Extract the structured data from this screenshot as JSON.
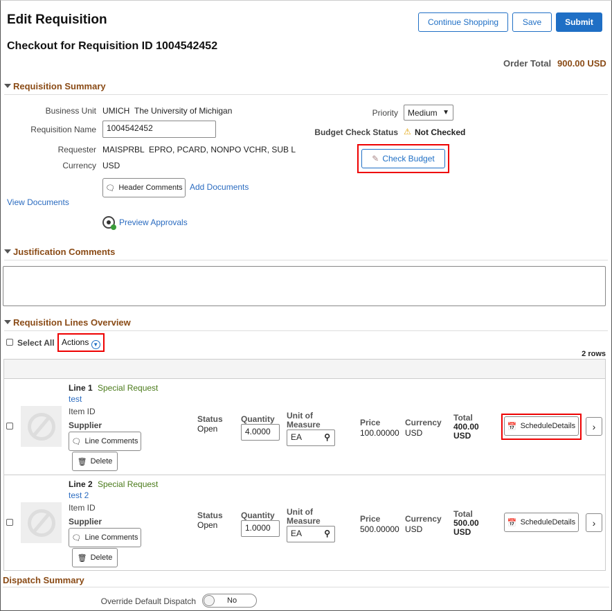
{
  "header": {
    "title": "Edit Requisition",
    "subtitle": "Checkout for Requisition ID 1004542452",
    "continue_shopping": "Continue Shopping",
    "save": "Save",
    "submit": "Submit",
    "order_total_label": "Order Total",
    "order_total_value": "900.00 USD"
  },
  "colors": {
    "accent": "#1f6fc5",
    "section": "#8a4b16",
    "highlight": "#e00000",
    "special": "#4a7a1a"
  },
  "summary": {
    "title": "Requisition Summary",
    "business_unit_label": "Business Unit",
    "business_unit_value": "UMICH",
    "business_unit_desc": "The University of Michigan",
    "req_name_label": "Requisition Name",
    "req_name_value": "1004542452",
    "requester_label": "Requester",
    "requester_value": "MAISPRBL",
    "requester_desc": "EPRO, PCARD, NONPO VCHR, SUB L",
    "currency_label": "Currency",
    "currency_value": "USD",
    "header_comments": "Header Comments",
    "add_documents": "Add Documents",
    "view_documents": "View Documents",
    "preview_approvals": "Preview Approvals",
    "priority_label": "Priority",
    "priority_value": "Medium",
    "budget_status_label": "Budget Check Status",
    "budget_status_value": "Not Checked",
    "check_budget": "Check Budget"
  },
  "justification": {
    "title": "Justification Comments",
    "value": ""
  },
  "lines": {
    "title": "Requisition Lines Overview",
    "select_all": "Select All",
    "actions": "Actions",
    "row_count": "2 rows",
    "items": [
      {
        "line": "Line 1",
        "type": "Special Request",
        "desc": "test",
        "item_id": "Item ID",
        "supplier": "Supplier",
        "line_comments": "Line Comments",
        "delete": "Delete",
        "status_label": "Status",
        "status": "Open",
        "qty_label": "Quantity",
        "qty": "4.0000",
        "uom_label": "Unit of",
        "uom_label2": "Measure",
        "uom": "EA",
        "price_label": "Price",
        "price": "100.00000",
        "currency_label": "Currency",
        "currency": "USD",
        "total_label": "Total",
        "total": "400.00",
        "total_cur": "USD",
        "schedule": "ScheduleDetails"
      },
      {
        "line": "Line 2",
        "type": "Special Request",
        "desc": "test 2",
        "item_id": "Item ID",
        "supplier": "Supplier",
        "line_comments": "Line Comments",
        "delete": "Delete",
        "status_label": "Status",
        "status": "Open",
        "qty_label": "Quantity",
        "qty": "1.0000",
        "uom_label": "Unit of",
        "uom_label2": "Measure",
        "uom": "EA",
        "price_label": "Price",
        "price": "500.00000",
        "currency_label": "Currency",
        "currency": "USD",
        "total_label": "Total",
        "total": "500.00",
        "total_cur": "USD",
        "schedule": "ScheduleDetails"
      }
    ]
  },
  "dispatch": {
    "title": "Dispatch Summary",
    "override_label": "Override Default Dispatch",
    "override_value": "No"
  }
}
